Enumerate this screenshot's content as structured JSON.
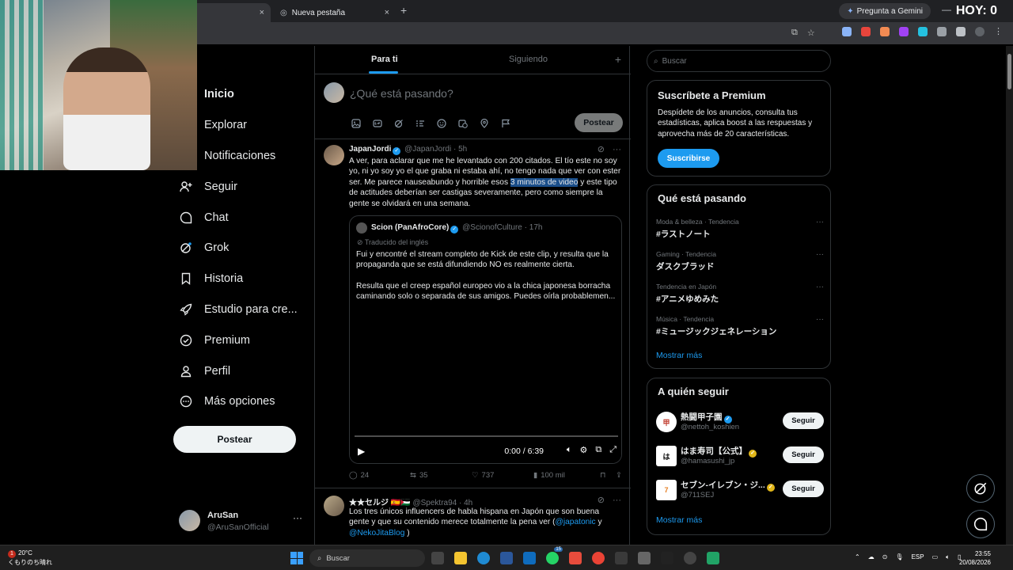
{
  "browser": {
    "tabs": [
      {
        "label": "",
        "close": "×"
      },
      {
        "label": "Nueva pestaña",
        "close": "×"
      }
    ],
    "new_tab": "+",
    "gemini_label": "Pregunta a Gemini",
    "overlay_text": "HOY: 0",
    "minimize": "—"
  },
  "nav": {
    "items": [
      {
        "label": "Inicio",
        "icon": "home-icon"
      },
      {
        "label": "Explorar",
        "icon": "search-icon"
      },
      {
        "label": "Notificaciones",
        "icon": "bell-icon"
      },
      {
        "label": "Seguir",
        "icon": "person-add-icon"
      },
      {
        "label": "Chat",
        "icon": "chat-icon"
      },
      {
        "label": "Grok",
        "icon": "grok-icon"
      },
      {
        "label": "Historia",
        "icon": "bookmark-icon"
      },
      {
        "label": "Estudio para cre...",
        "icon": "rocket-icon"
      },
      {
        "label": "Premium",
        "icon": "verified-icon"
      },
      {
        "label": "Perfil",
        "icon": "user-icon"
      },
      {
        "label": "Más opciones",
        "icon": "more-icon"
      }
    ],
    "post_button": "Postear",
    "account": {
      "name": "AruSan",
      "handle": "@AruSanOfficial",
      "menu": "···"
    }
  },
  "feed": {
    "tabs": [
      "Para ti",
      "Siguiendo"
    ],
    "add": "+",
    "composer": {
      "placeholder": "¿Qué está pasando?",
      "post_button": "Postear"
    },
    "tweet": {
      "name": "JapanJordi",
      "handle": "@JapanJordi",
      "time": "· 5h",
      "menu": "···",
      "text_before": "A ver, para aclarar que me he levantado con 200 citados. El tío este no soy yo, ni yo soy yo el que graba ni estaba ahí, no tengo nada que ver con ester ser. Me parece nauseabundo y horrible esos ",
      "text_highlight": "3 minutos de video",
      "text_after": " y este tipo de actitudes deberían ser castigas severamente, pero como siempre la gente se olvidará en una semana.",
      "quote": {
        "name": "Scion (PanAfroCore)",
        "handle": "@ScionofCulture",
        "time": "· 17h",
        "translated": "Traducido del inglés",
        "text1": "Fui y encontré el stream completo de Kick de este clip, y resulta que la propaganda que se está difundiendo NO es realmente cierta.",
        "text2": "Resulta que el creep español europeo vio a la chica japonesa borracha caminando solo o separada de sus amigos. Puedes oírla probablemen...",
        "video_time": "0:00 / 6:39"
      },
      "stats": {
        "replies": "24",
        "reposts": "35",
        "likes": "737",
        "views": "100 mil"
      }
    },
    "tweet2": {
      "name": "★★セルジ 🇪🇸🇵🇸",
      "handle": "@Spektra94",
      "time": "· 4h",
      "menu": "···",
      "text": "Los tres únicos influencers de habla hispana en Japón  que son buena gente y que su contenido merece totalmente la pena ver (",
      "link1": "@japatonic",
      "mid": " y ",
      "link2": "@NekoJitaBlog",
      "end": " )"
    }
  },
  "sidebar": {
    "search_placeholder": "Buscar",
    "premium": {
      "title": "Suscríbete a Premium",
      "text": "Despídete de los anuncios, consulta tus estadísticas, aplica boost a las respuestas y aprovecha más de 20 características.",
      "button": "Suscribirse"
    },
    "trends": {
      "title": "Qué está pasando",
      "items": [
        {
          "category": "Moda & belleza · Tendencia",
          "name": "#ラストノート"
        },
        {
          "category": "Gaming · Tendencia",
          "name": "ダスクブラッド"
        },
        {
          "category": "Tendencia en Japón",
          "name": "#アニメゆめみた"
        },
        {
          "category": "Música · Tendencia",
          "name": "#ミュージックジェネレーション"
        }
      ],
      "more": "···",
      "show_more": "Mostrar más"
    },
    "follow": {
      "title": "A quién seguir",
      "items": [
        {
          "name": "熱闘甲子園",
          "handle": "@nettoh_koshien",
          "button": "Seguir"
        },
        {
          "name": "はま寿司【公式】",
          "handle": "@hamasushi_jp",
          "button": "Seguir"
        },
        {
          "name": "セブン-イレブン・ジ...",
          "handle": "@711SEJ",
          "button": "Seguir"
        }
      ],
      "show_more": "Mostrar más"
    }
  },
  "taskbar": {
    "weather_badge": "1",
    "temperature": "20°C",
    "weather_desc": "くもりのち晴れ",
    "search": "Buscar",
    "whatsapp_badge": "15",
    "lang": "ESP",
    "time": "23:55",
    "date": "20/08/2026"
  },
  "colors": {
    "accent": "#1d9bf0",
    "background": "#000000",
    "border": "#2f3336",
    "muted": "#71767b"
  }
}
